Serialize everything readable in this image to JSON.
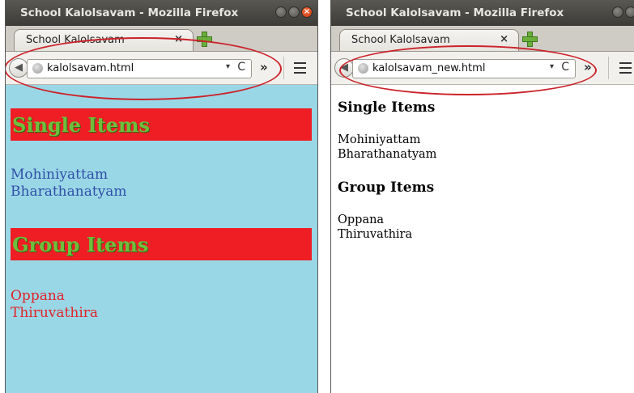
{
  "windows": [
    {
      "title": "School Kalolsavam - Mozilla Firefox",
      "tab_label": "School Kalolsavam",
      "url": "kalolsavam.html",
      "single_heading": "Single Items",
      "single_items": [
        "Mohiniyattam",
        "Bharathanatyam"
      ],
      "group_heading": "Group Items",
      "group_items": [
        "Oppana",
        "Thiruvathira"
      ],
      "colors": {
        "page_bg": "#9ad7e6",
        "heading_bg": "#ee1e24",
        "heading_text": "#6fbf3c",
        "single_text": "#2f4fa8",
        "group_text": "#e1242a"
      }
    },
    {
      "title": "School Kalolsavam - Mozilla Firefox",
      "tab_label": "School Kalolsavam",
      "url": "kalolsavam_new.html",
      "single_heading": "Single Items",
      "single_items": [
        "Mohiniyattam",
        "Bharathanatyam"
      ],
      "group_heading": "Group Items",
      "group_items": [
        "Oppana",
        "Thiruvathira"
      ],
      "colors": {
        "page_bg": "#ffffff",
        "text": "#000000"
      }
    }
  ],
  "chrome": {
    "close_glyph": "×",
    "tab_close_glyph": "×",
    "dropdown_glyph": "▾",
    "reload_glyph": "C",
    "overflow_glyph": "»",
    "back_glyph": "◀",
    "annotation_color": "#cc2229"
  }
}
